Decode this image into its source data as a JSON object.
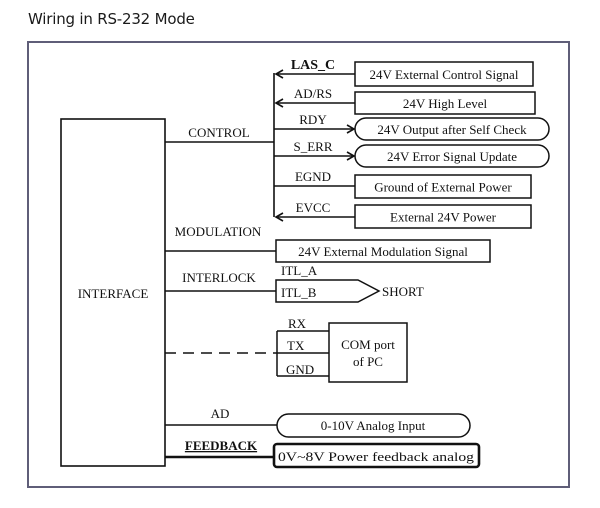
{
  "title": "Wiring in RS-232 Mode",
  "interface": {
    "label": "INTERFACE"
  },
  "groups": {
    "control": "CONTROL",
    "modulation": "MODULATION",
    "interlock": "INTERLOCK",
    "ad": "AD",
    "feedback": "FEEDBACK"
  },
  "control_signals": [
    {
      "pin": "LAS_C",
      "label": "24V External Control Signal",
      "direction": "in",
      "shape": "rect",
      "pin_bold": true
    },
    {
      "pin": "AD/RS",
      "label": "24V High Level",
      "direction": "in",
      "shape": "rect",
      "pin_bold": false
    },
    {
      "pin": "RDY",
      "label": "24V Output after Self Check",
      "direction": "out",
      "shape": "pill",
      "pin_bold": false
    },
    {
      "pin": "S_ERR",
      "label": "24V Error Signal Update",
      "direction": "out",
      "shape": "pill",
      "pin_bold": false
    },
    {
      "pin": "EGND",
      "label": "Ground of External Power",
      "direction": "none",
      "shape": "rect",
      "pin_bold": false
    },
    {
      "pin": "EVCC",
      "label": "External 24V Power",
      "direction": "in",
      "shape": "rect",
      "pin_bold": false
    }
  ],
  "modulation": {
    "label": "24V External Modulation Signal"
  },
  "interlock": {
    "pin_a": "ITL_A",
    "pin_b": "ITL_B",
    "result": "SHORT"
  },
  "com": {
    "pins": [
      "RX",
      "TX",
      "GND"
    ],
    "label_line1": "COM port",
    "label_line2": "of PC"
  },
  "analog": {
    "label": "0-10V Analog Input"
  },
  "feedback": {
    "label": "0V~8V Power feedback analog"
  }
}
